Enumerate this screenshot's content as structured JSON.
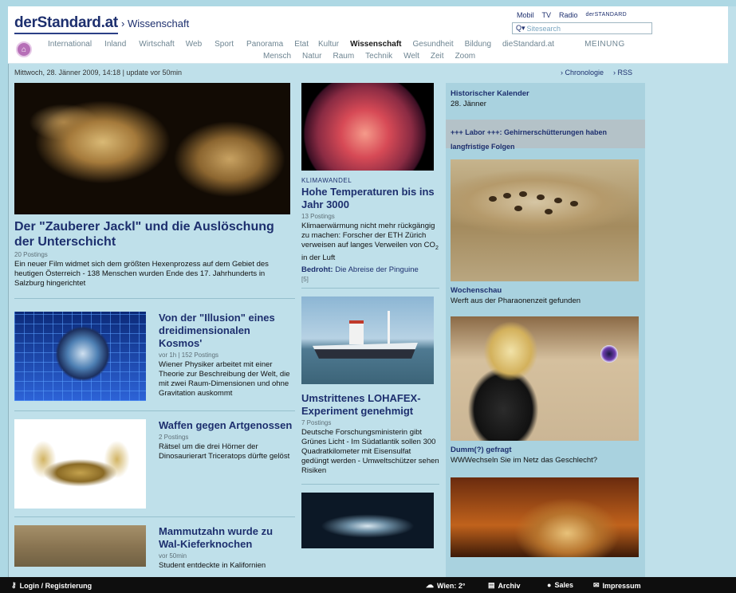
{
  "header": {
    "logo": "derStandard.at",
    "section": "› Wissenschaft",
    "top_links": [
      "Mobil",
      "TV",
      "Radio"
    ],
    "brand_link": "derSTANDARD",
    "search_placeholder": "Sitesearch"
  },
  "nav": {
    "primary": [
      "International",
      "Inland",
      "Wirtschaft",
      "Web",
      "Sport",
      "Panorama",
      "Etat",
      "Kultur",
      "Wissenschaft",
      "Gesundheit",
      "Bildung",
      "dieStandard.at",
      "MEINUNG"
    ],
    "active": "Wissenschaft",
    "secondary": [
      "Mensch",
      "Natur",
      "Raum",
      "Technik",
      "Welt",
      "Zeit",
      "Zoom"
    ]
  },
  "dateline": "Mittwoch, 28. Jänner 2009, 14:18 | update vor 50min",
  "date_links": {
    "chronologie": "› Chronologie",
    "rss": "› RSS"
  },
  "left": {
    "lead": {
      "title": "Der \"Zauberer Jackl\" und die Auslöschung der Unterschicht",
      "postings": "20 Postings",
      "teaser": "Ein neuer Film widmet sich dem größten Hexenprozess auf dem Gebiet des heutigen Österreich - 138 Menschen wurden Ende des 17. Jahrhunderts in Salzburg hingerichtet"
    },
    "stories": [
      {
        "title": "Von der \"Illusion\" eines dreidimensionalen Kosmos'",
        "postings": "vor 1h | 152 Postings",
        "teaser": "Wiener Physiker arbeitet mit einer Theorie zur Beschreibung der Welt, die mit zwei Raum-Dimensionen und ohne Gravitation auskommt"
      },
      {
        "title": "Waffen gegen Artgenossen",
        "postings": "2 Postings",
        "teaser": "Rätsel um die drei Hörner der Dinosaurierart Triceratops dürfte gelöst"
      },
      {
        "title": "Mammutzahn wurde zu Wal-Kieferknochen",
        "postings": "vor 50min",
        "teaser": "Student entdeckte in Kalifornien"
      }
    ]
  },
  "middle": {
    "story1": {
      "kicker": "KLIMAWANDEL",
      "title": "Hohe Temperaturen bis ins Jahr 3000",
      "postings": "13 Postings",
      "teaser_a": "Klimaerwärmung nicht mehr rückgängig zu machen: Forscher der ETH Zürich verweisen auf langes Verweilen von CO",
      "teaser_sub": "2",
      "teaser_b": " in der Luft",
      "related_label": "Bedroht:",
      "related_text": " Die Abreise der Pinguine",
      "related_count": "[5]"
    },
    "story2": {
      "title": "Umstrittenes LOHAFEX-Experiment genehmigt",
      "postings": "7 Postings",
      "teaser": "Deutsche Forschungsministerin gibt Grünes Licht - Im Südatlantik sollen 300 Quadratkilometer mit Eisensulfat gedüngt werden - Umweltschützer sehen Risiken"
    }
  },
  "right": {
    "kalender_title": "Historischer Kalender",
    "kalender_date": "28. Jänner",
    "labor": "+++ Labor +++: Gehirnerschütterungen haben langfristige Folgen",
    "wochenschau_title": "Wochenschau",
    "wochenschau_text": "Werft aus der Pharaonenzeit gefunden",
    "dumm_title": "Dumm(?) gefragt",
    "dumm_text": "WWWechseln Sie im Netz das Geschlecht?"
  },
  "footer": {
    "login": "Login / Registrierung",
    "weather": "Wien: 2°",
    "archiv": "Archiv",
    "sales": "Sales",
    "impressum": "Impressum"
  }
}
